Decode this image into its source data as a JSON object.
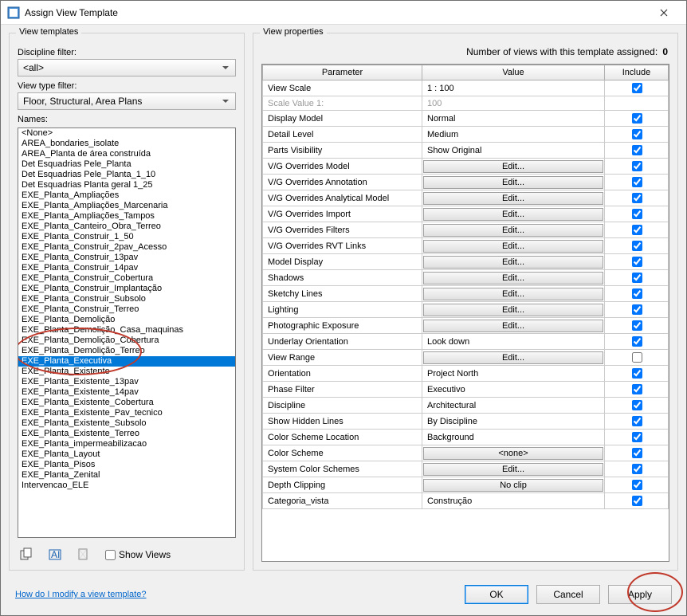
{
  "titlebar": {
    "title": "Assign View Template"
  },
  "leftPanel": {
    "legend": "View templates",
    "disciplineLabel": "Discipline filter:",
    "disciplineValue": "<all>",
    "viewTypeLabel": "View type filter:",
    "viewTypeValue": "Floor, Structural, Area Plans",
    "namesLabel": "Names:",
    "names": [
      "<None>",
      "AREA_bondaries_isolate",
      "AREA_Planta de área construída",
      "Det Esquadrias Pele_Planta",
      "Det Esquadrias Pele_Planta_1_10",
      "Det Esquadrias Planta geral 1_25",
      "EXE_Planta_Ampliações",
      "EXE_Planta_Ampliações_Marcenaria",
      "EXE_Planta_Ampliações_Tampos",
      "EXE_Planta_Canteiro_Obra_Terreo",
      "EXE_Planta_Construir_1_50",
      "EXE_Planta_Construir_2pav_Acesso",
      "EXE_Planta_Construir_13pav",
      "EXE_Planta_Construir_14pav",
      "EXE_Planta_Construir_Cobertura",
      "EXE_Planta_Construir_Implantação",
      "EXE_Planta_Construir_Subsolo",
      "EXE_Planta_Construir_Terreo",
      "EXE_Planta_Demolição",
      "EXE_Planta_Demolição_Casa_maquinas",
      "EXE_Planta_Demolição_Cobertura",
      "EXE_Planta_Demolição_Terreo",
      "EXE_Planta_Executiva",
      "EXE_Planta_Existente",
      "EXE_Planta_Existente_13pav",
      "EXE_Planta_Existente_14pav",
      "EXE_Planta_Existente_Cobertura",
      "EXE_Planta_Existente_Pav_tecnico",
      "EXE_Planta_Existente_Subsolo",
      "EXE_Planta_Existente_Terreo",
      "EXE_Planta_impermeabilizacao",
      "EXE_Planta_Layout",
      "EXE_Planta_Pisos",
      "EXE_Planta_Zenital",
      "Intervencao_ELE"
    ],
    "selectedIndex": 22,
    "showViewsLabel": "Show Views"
  },
  "rightPanel": {
    "legend": "View properties",
    "countLabel": "Number of views with this template assigned:",
    "countValue": "0",
    "headers": {
      "param": "Parameter",
      "value": "Value",
      "include": "Include"
    },
    "rows": [
      {
        "param": "View Scale",
        "value": "1 : 100",
        "type": "text",
        "include": true
      },
      {
        "param": "Scale Value    1:",
        "value": "100",
        "type": "greyed",
        "include": null
      },
      {
        "param": "Display Model",
        "value": "Normal",
        "type": "text",
        "include": true
      },
      {
        "param": "Detail Level",
        "value": "Medium",
        "type": "text",
        "include": true
      },
      {
        "param": "Parts Visibility",
        "value": "Show Original",
        "type": "text",
        "include": true
      },
      {
        "param": "V/G Overrides Model",
        "value": "Edit...",
        "type": "button",
        "include": true
      },
      {
        "param": "V/G Overrides Annotation",
        "value": "Edit...",
        "type": "button",
        "include": true
      },
      {
        "param": "V/G Overrides Analytical Model",
        "value": "Edit...",
        "type": "button",
        "include": true
      },
      {
        "param": "V/G Overrides Import",
        "value": "Edit...",
        "type": "button",
        "include": true
      },
      {
        "param": "V/G Overrides Filters",
        "value": "Edit...",
        "type": "button",
        "include": true
      },
      {
        "param": "V/G Overrides RVT Links",
        "value": "Edit...",
        "type": "button",
        "include": true
      },
      {
        "param": "Model Display",
        "value": "Edit...",
        "type": "button",
        "include": true
      },
      {
        "param": "Shadows",
        "value": "Edit...",
        "type": "button",
        "include": true
      },
      {
        "param": "Sketchy Lines",
        "value": "Edit...",
        "type": "button",
        "include": true
      },
      {
        "param": "Lighting",
        "value": "Edit...",
        "type": "button",
        "include": true
      },
      {
        "param": "Photographic Exposure",
        "value": "Edit...",
        "type": "button",
        "include": true
      },
      {
        "param": "Underlay Orientation",
        "value": "Look down",
        "type": "text",
        "include": true
      },
      {
        "param": "View Range",
        "value": "Edit...",
        "type": "button",
        "include": false
      },
      {
        "param": "Orientation",
        "value": "Project North",
        "type": "text",
        "include": true
      },
      {
        "param": "Phase Filter",
        "value": "Executivo",
        "type": "text",
        "include": true
      },
      {
        "param": "Discipline",
        "value": "Architectural",
        "type": "text",
        "include": true
      },
      {
        "param": "Show Hidden Lines",
        "value": "By Discipline",
        "type": "text",
        "include": true
      },
      {
        "param": "Color Scheme Location",
        "value": "Background",
        "type": "text",
        "include": true
      },
      {
        "param": "Color Scheme",
        "value": "<none>",
        "type": "button",
        "include": true
      },
      {
        "param": "System Color Schemes",
        "value": "Edit...",
        "type": "button",
        "include": true
      },
      {
        "param": "Depth Clipping",
        "value": "No clip",
        "type": "button",
        "include": true
      },
      {
        "param": "Categoria_vista",
        "value": "Construção",
        "type": "text",
        "include": true
      }
    ]
  },
  "footer": {
    "helpLink": "How do I modify a view template?",
    "ok": "OK",
    "cancel": "Cancel",
    "apply": "Apply"
  }
}
